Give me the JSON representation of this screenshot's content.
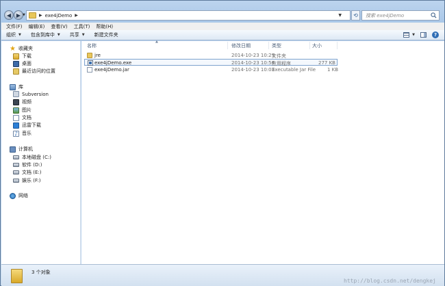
{
  "address_bar": {
    "path_segment": "exe4jDemo",
    "search_placeholder": "搜索 exe4jDemo"
  },
  "menu": [
    "文件(F)",
    "编辑(E)",
    "查看(V)",
    "工具(T)",
    "帮助(H)"
  ],
  "toolbar": {
    "organize_label": "组织",
    "include_in_library_label": "包含到库中",
    "share_label": "共享",
    "new_folder_label": "新建文件夹"
  },
  "nav": {
    "favorites": {
      "label": "收藏夹",
      "items": [
        "下载",
        "桌面",
        "最近访问的位置"
      ]
    },
    "libraries": {
      "label": "库",
      "items": [
        "Subversion",
        "视频",
        "图片",
        "文档",
        "迅雷下载",
        "音乐"
      ]
    },
    "computer": {
      "label": "计算机",
      "items": [
        "本地磁盘 (C:)",
        "软件 (D:)",
        "文档 (E:)",
        "娱乐 (F:)"
      ]
    },
    "network": {
      "label": "网络"
    }
  },
  "columns": [
    "名称",
    "修改日期",
    "类型",
    "大小"
  ],
  "files": [
    {
      "name": "jre",
      "modified": "2014-10-23 10:29",
      "type": "文件夹",
      "size": "",
      "icon": "folder-icon"
    },
    {
      "name": "exe4jDemo.exe",
      "modified": "2014-10-23 10:56",
      "type": "应用程序",
      "size": "277 KB",
      "icon": "exe-icon",
      "selected": true
    },
    {
      "name": "exe4jDemo.jar",
      "modified": "2014-10-23 10:03",
      "type": "Executable Jar File",
      "size": "1 KB",
      "icon": "jar-icon"
    }
  ],
  "status": {
    "item_count": "3 个对象"
  },
  "watermark": "http://blog.csdn.net/dengkej"
}
